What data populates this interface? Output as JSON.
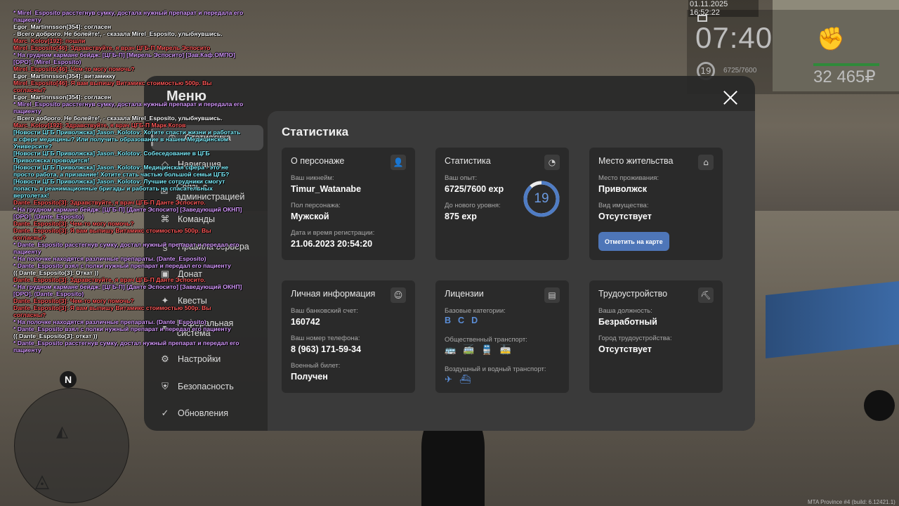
{
  "chat": [
    {
      "cls": "c-purple",
      "text": " * Mirel_Esposito расстегнув сумку, достала нужный препарат и передала его пациенту"
    },
    {
      "cls": "c-white",
      "text": "Egor_Martinnsson[354]: согласен"
    },
    {
      "cls": "c-white",
      "text": "- Всего доброго. Не болейте!, - сказала Mirel_Esposito, улыбнувшись."
    },
    {
      "cls": "c-red",
      "text": "Marc_Kolov[192]: пошли"
    },
    {
      "cls": "c-red",
      "text": "Mirel_Esposito[46]: Здравствуйте, я врач ЦГБ-П Мирель Эспосито"
    },
    {
      "cls": "c-purple",
      "text": " * На грудном кармане бейдж: [ЦГБ-П] [Мирель Эспосито] [Зав.Каф.ОМПО] [ОРО]. (Mirel_Esposito)"
    },
    {
      "cls": "c-red",
      "text": "Mirel_Esposito[46]: Чем-то могу помочь?"
    },
    {
      "cls": "c-white",
      "text": "Egor_Martinnsson[354]: витамикку"
    },
    {
      "cls": "c-red",
      "text": "Mirel_Esposito[46]: Я вам выпишу Витамикс стоимостью 500р. Вы согласны?"
    },
    {
      "cls": "c-white",
      "text": "Egor_Martinnsson[354]: согласен"
    },
    {
      "cls": "c-purple",
      "text": " * Mirel_Esposito расстегнув сумку, достала нужный препарат и передала его пациенту"
    },
    {
      "cls": "c-white",
      "text": "- Всего доброго. Не болейте!, - сказала Mirel_Esposito, улыбнувшись."
    },
    {
      "cls": "c-red",
      "text": "Marc_Kolov[192]: Здравствуйте, я врач ЦГБ-П Марк Котов"
    },
    {
      "cls": "c-cyan",
      "text": "[Новости ЦГБ Приволжска] Jason_Kolotov: Хотите спасти жизни и работать в сфере медицины? Или получить образование в нашем Медицинском Университе?"
    },
    {
      "cls": "c-cyan",
      "text": "[Новости ЦГБ Приволжска] Jason_Kolotov: Собеседование в ЦГБ Приволжска проводится!"
    },
    {
      "cls": "c-cyan",
      "text": "[Новости ЦГБ Приволжска] Jason_Kolotov: Медицинская сфера - это не просто работа, а призвание! Хотите стать частью большой семьи ЦГБ?"
    },
    {
      "cls": "c-cyan",
      "text": "[Новости ЦГБ Приволжска] Jason_Kolotov: Лучшие сотрудники смогут попасть в реанимационные бригады и работать на спасательных вертолетах!"
    },
    {
      "cls": "c-red",
      "text": "Dante_Esposito[3]: Здравствуйте, я врач ЦГБ-П Данте Эспосито."
    },
    {
      "cls": "c-purple",
      "text": " * На грудном кармане бейдж: [ЦГБ-П] [Данте Эспосито] [Заведующий ОКНП] [ОРО]. (Dante_Esposito)"
    },
    {
      "cls": "c-red",
      "text": "Dante_Esposito[3]: Чем-то могу помочь?"
    },
    {
      "cls": "c-red",
      "text": "Dante_Esposito[3]: Я вам выпишу Витамикс стоимостью 500р. Вы согласны?"
    },
    {
      "cls": "c-purple",
      "text": " * Dante_Esposito расстегнув сумку, достал нужный препарат и передал его пациенту"
    },
    {
      "cls": "c-purple",
      "text": " * На полочке находятся различные препараты. (Dante_Esposito)"
    },
    {
      "cls": "c-purple",
      "text": " * Dante_Esposito взял с полки нужный препарат и передал его пациенту"
    },
    {
      "cls": "c-white",
      "text": "(( Dante_Esposito[3]: Откат ))"
    },
    {
      "cls": "c-red",
      "text": "Dante_Esposito[3]: Здравствуйте, я врач ЦГБ-П Данте Эспосито."
    },
    {
      "cls": "c-purple",
      "text": " * На грудном кармане бейдж: [ЦГБ-П] [Данте Эспосито] [Заведующий ОКНП] [ОРО]. (Dante_Esposito)"
    },
    {
      "cls": "c-red",
      "text": "Dante_Esposito[3]: Чем-то могу помочь?"
    },
    {
      "cls": "c-red",
      "text": "Dante_Esposito[3]: Я вам выпишу Витамикс стоимостью 500р. Вы согласны?"
    },
    {
      "cls": "c-purple",
      "text": " * На полочке находятся различные препараты. (Dante_Esposito)"
    },
    {
      "cls": "c-purple",
      "text": " * Dante_Esposito взял с полки нужный препарат и передал его пациенту"
    },
    {
      "cls": "c-white",
      "text": "(( Dante_Esposito[3]: откат ))"
    },
    {
      "cls": "c-purple",
      "text": " * Dante_Esposito расстегнув сумку, достал нужный препарат и передал его пациенту"
    }
  ],
  "hud": {
    "datetime": "01.11.2025 16:52:22",
    "time": "07:40",
    "level": "19",
    "exp": "6725/7600",
    "money": "32 465₽"
  },
  "minimap": {
    "north": "N"
  },
  "watermark": "MTA Province #4 (build: 6.12421.1)",
  "menu": {
    "title": "Меню",
    "nav": [
      {
        "label": "Статистика",
        "icon": "◷"
      },
      {
        "label": "Навигация",
        "icon": "◇"
      },
      {
        "label": "Связь с администрацией",
        "icon": "✉"
      },
      {
        "label": "Команды",
        "icon": "⌘"
      },
      {
        "label": "Правила сервера",
        "icon": "§"
      },
      {
        "label": "Донат",
        "icon": "▣"
      },
      {
        "label": "Квесты",
        "icon": "✦"
      },
      {
        "label": "Реферальная система",
        "icon": "⚭"
      },
      {
        "label": "Настройки",
        "icon": "⚙"
      },
      {
        "label": "Безопасность",
        "icon": "⛨"
      },
      {
        "label": "Обновления",
        "icon": "✓"
      }
    ],
    "panel_title": "Статистика"
  },
  "cards": {
    "person": {
      "title": "О персонаже",
      "nick_label": "Ваш никнейм:",
      "nick": "Timur_Watanabe",
      "gender_label": "Пол персонажа:",
      "gender": "Мужской",
      "reg_label": "Дата и время регистрации:",
      "reg": "21.06.2023 20:54:20"
    },
    "stats": {
      "title": "Статистика",
      "exp_label": "Ваш опыт:",
      "exp": "6725/7600 exp",
      "next_label": "До нового уровня:",
      "next": "875 exp",
      "level": "19",
      "level_progress": 0.885
    },
    "home": {
      "title": "Место жительства",
      "place_label": "Место проживания:",
      "place": "Приволжск",
      "prop_label": "Вид имущества:",
      "prop": "Отсутствует",
      "map_button": "Отметить на карте"
    },
    "personal": {
      "title": "Личная информация",
      "bank_label": "Ваш банковский счет:",
      "bank": "160742",
      "phone_label": "Ваш номер телефона:",
      "phone": "8 (963) 171-59-34",
      "military_label": "Военный билет:",
      "military": "Получен"
    },
    "licenses": {
      "title": "Лицензии",
      "base_label": "Базовые категории:",
      "categories": [
        "B",
        "C",
        "D"
      ],
      "public_label": "Общественный транспорт:",
      "air_label": "Воздушный и водный транспорт:"
    },
    "job": {
      "title": "Трудоустройство",
      "pos_label": "Ваша должность:",
      "pos": "Безработный",
      "city_label": "Город трудоустройства:",
      "city": "Отсутствует"
    }
  },
  "colors": {
    "accent": "#5b8ed8",
    "button": "#4e76b8",
    "panel": "#3a3a3a",
    "card": "#2a2a2a"
  }
}
